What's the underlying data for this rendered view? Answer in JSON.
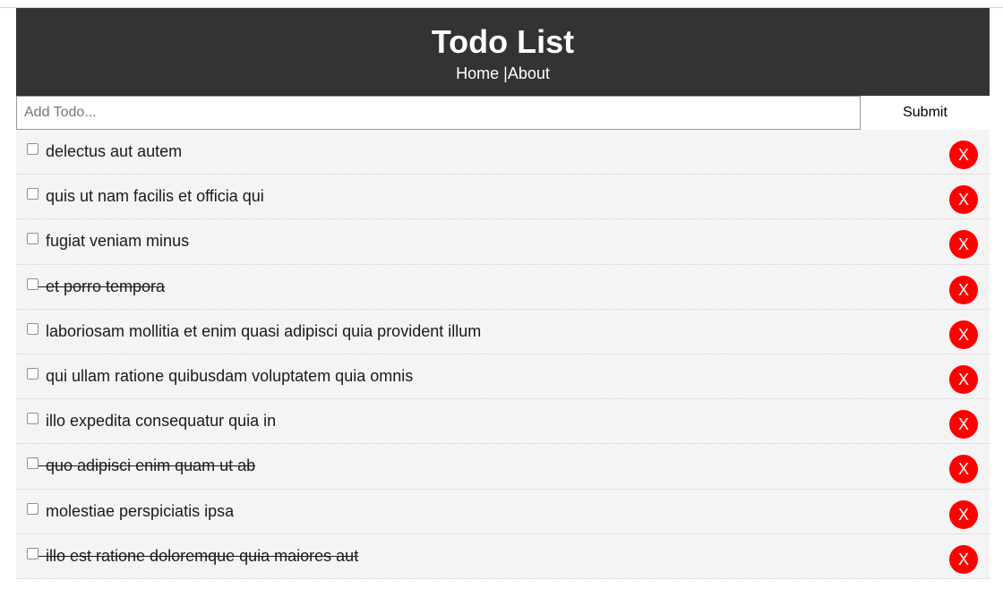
{
  "header": {
    "title": "Todo List",
    "nav": {
      "home": "Home",
      "separator": " |",
      "about": "About"
    }
  },
  "add_form": {
    "placeholder": "Add Todo...",
    "value": "",
    "submit_label": "Submit"
  },
  "todos": [
    {
      "title": "delectus aut autem",
      "completed": false,
      "delete_label": "X"
    },
    {
      "title": "quis ut nam facilis et officia qui",
      "completed": false,
      "delete_label": "X"
    },
    {
      "title": "fugiat veniam minus",
      "completed": false,
      "delete_label": "X"
    },
    {
      "title": "et porro tempora",
      "completed": true,
      "delete_label": "X"
    },
    {
      "title": "laboriosam mollitia et enim quasi adipisci quia provident illum",
      "completed": false,
      "delete_label": "X"
    },
    {
      "title": "qui ullam ratione quibusdam voluptatem quia omnis",
      "completed": false,
      "delete_label": "X"
    },
    {
      "title": "illo expedita consequatur quia in",
      "completed": false,
      "delete_label": "X"
    },
    {
      "title": "quo adipisci enim quam ut ab",
      "completed": true,
      "delete_label": "X"
    },
    {
      "title": "molestiae perspiciatis ipsa",
      "completed": false,
      "delete_label": "X"
    },
    {
      "title": "illo est ratione doloremque quia maiores aut",
      "completed": true,
      "delete_label": "X"
    }
  ],
  "colors": {
    "header_bg": "#333333",
    "delete_button": "#ff0000",
    "item_bg": "#f4f4f4"
  }
}
